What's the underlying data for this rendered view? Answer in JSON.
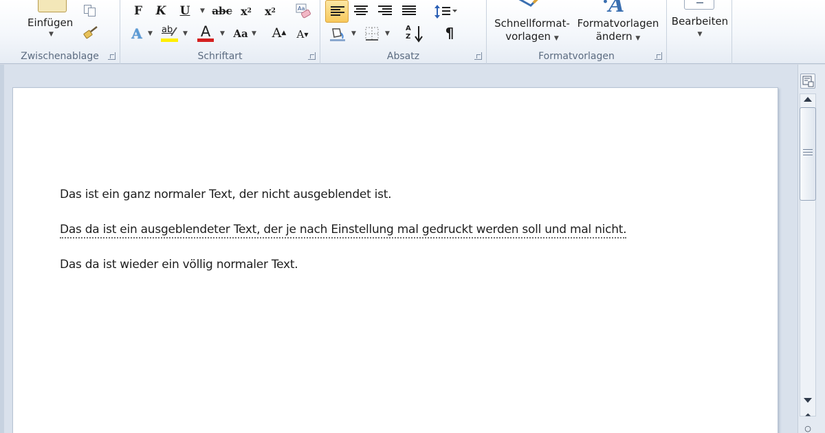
{
  "ribbon": {
    "clipboard": {
      "paste_label": "Einfügen",
      "group_label": "Zwischenablage"
    },
    "font": {
      "group_label": "Schriftart",
      "bold": "F",
      "italic": "K",
      "underline": "U",
      "strike": "abc",
      "subscript": "x",
      "subscript_mark": "2",
      "superscript": "x",
      "superscript_mark": "2",
      "text_effects": "A",
      "highlight": "ab",
      "font_color": "A",
      "change_case": "Aa",
      "grow_font": "A",
      "shrink_font": "A",
      "highlight_color": "#ffee00",
      "font_color_value": "#d42020"
    },
    "paragraph": {
      "group_label": "Absatz",
      "pilcrow": "¶",
      "sort": "AZ"
    },
    "styles": {
      "group_label": "Formatvorlagen",
      "quick_styles_line1": "Schnellformat-",
      "quick_styles_line2": "vorlagen",
      "change_styles_line1": "Formatvorlagen",
      "change_styles_line2": "ändern"
    },
    "editing": {
      "label": "Bearbeiten"
    }
  },
  "document": {
    "paragraphs": [
      {
        "text": "Das ist ein ganz normaler Text, der nicht ausgeblendet ist.",
        "hidden": false
      },
      {
        "text": "Das da ist ein ausgeblendeter Text, der je nach Einstellung mal gedruckt werden soll und mal nicht.",
        "hidden": true
      },
      {
        "text": "Das da ist wieder ein völlig normaler Text.",
        "hidden": false
      }
    ]
  }
}
